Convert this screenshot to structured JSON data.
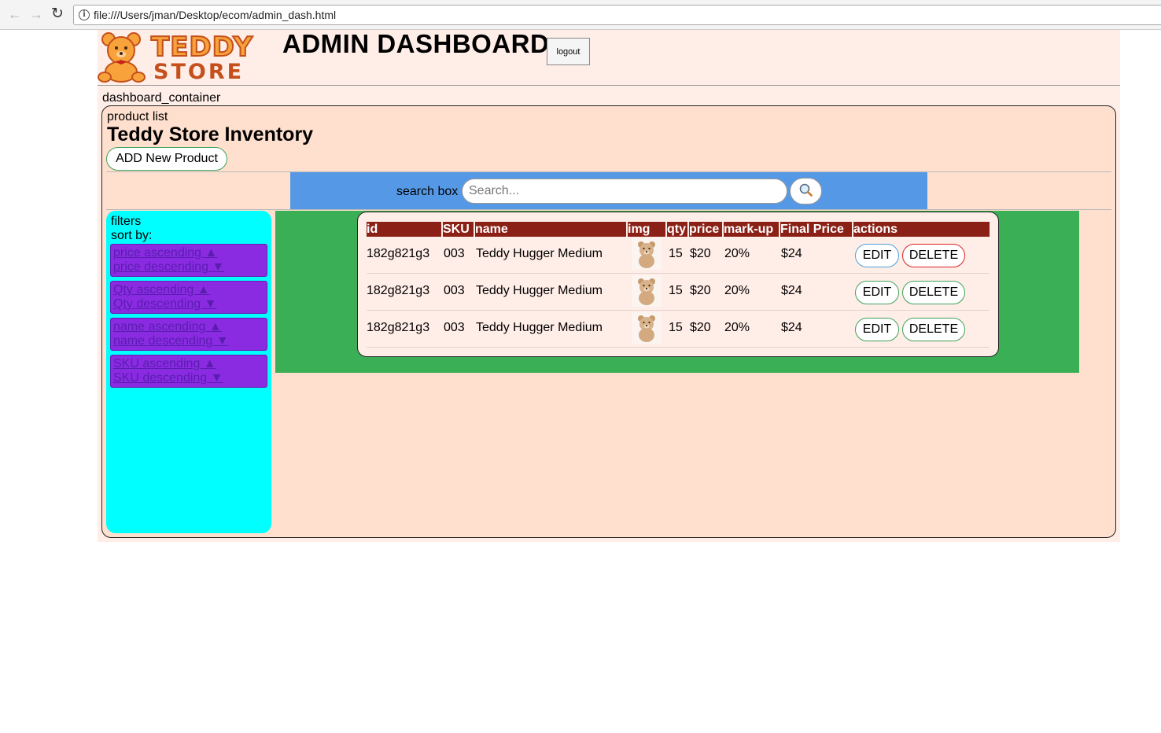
{
  "browser": {
    "url": "file:///Users/jman/Desktop/ecom/admin_dash.html"
  },
  "header": {
    "logo_line1": "TEDDY",
    "logo_line2": "STORE",
    "title": "ADMIN DASHBOARD",
    "logout_label": "logout"
  },
  "dashboard": {
    "container_label": "dashboard_container",
    "product_list_label": "product list",
    "inventory_title": "Teddy Store Inventory",
    "add_button_label": "ADD New Product",
    "search": {
      "label": "search box",
      "placeholder": "Search..."
    }
  },
  "filters": {
    "label": "filters",
    "sort_label": "sort by:",
    "groups": [
      {
        "asc": "price ascending ▲",
        "desc": "price descending ▼"
      },
      {
        "asc": "Qty ascending ▲",
        "desc": "Qty descending ▼"
      },
      {
        "asc": "name ascending ▲",
        "desc": "name descending ▼"
      },
      {
        "asc": "SKU ascending ▲",
        "desc": "SKU descending ▼"
      }
    ]
  },
  "table": {
    "headers": [
      "id",
      "SKU",
      "name",
      "img",
      "qty",
      "price",
      "mark-up",
      "Final Price",
      "actions"
    ],
    "rows": [
      {
        "id": "182g821g3",
        "sku": "003",
        "name": "Teddy Hugger Medium",
        "qty": "15",
        "price": "$20",
        "markup": "20%",
        "final": "$24"
      },
      {
        "id": "182g821g3",
        "sku": "003",
        "name": "Teddy Hugger Medium",
        "qty": "15",
        "price": "$20",
        "markup": "20%",
        "final": "$24"
      },
      {
        "id": "182g821g3",
        "sku": "003",
        "name": "Teddy Hugger Medium",
        "qty": "15",
        "price": "$20",
        "markup": "20%",
        "final": "$24"
      }
    ],
    "edit_label": "EDIT",
    "delete_label": "DELETE"
  },
  "colors": {
    "page_bg": "#ffede7",
    "inventory_bg": "#ffe0ce",
    "search_strip": "#5599e6",
    "filters_bg": "#00ffff",
    "sort_group_bg": "#8a2be2",
    "table_area_bg": "#3aaf55",
    "table_header_bg": "#8b2116"
  }
}
